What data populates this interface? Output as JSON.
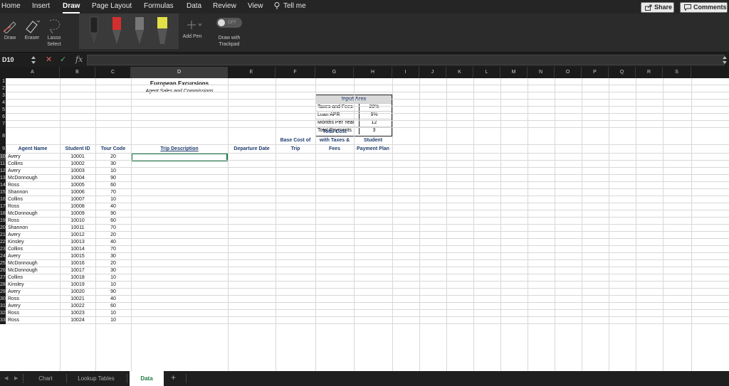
{
  "ribbon": {
    "tabs": [
      "Home",
      "Insert",
      "Draw",
      "Page Layout",
      "Formulas",
      "Data",
      "Review",
      "View"
    ],
    "active_tab": "Draw",
    "tell_me": "Tell me",
    "share": "Share",
    "comments": "Comments"
  },
  "toolbar": {
    "draw": "Draw",
    "eraser": "Eraser",
    "lasso_line1": "Lasso",
    "lasso_line2": "Select",
    "add_pen": "Add Pen",
    "toggle": "OFF",
    "trackpad_line1": "Draw with",
    "trackpad_line2": "Trackpad",
    "pen_colors": [
      "#222222",
      "#d32f2f",
      "#555555",
      "#e4e048"
    ]
  },
  "formula_bar": {
    "name_box": "D10",
    "cancel": "✕",
    "confirm": "✓",
    "fx": "fx",
    "value": ""
  },
  "columns": [
    "A",
    "B",
    "C",
    "D",
    "E",
    "F",
    "G",
    "H",
    "I",
    "J",
    "K",
    "L",
    "M",
    "N",
    "O",
    "P",
    "Q",
    "R",
    "S"
  ],
  "rows": [
    "1",
    "2",
    "3",
    "4",
    "5",
    "6",
    "7",
    "8",
    "9",
    "10",
    "11",
    "12",
    "13",
    "14",
    "15",
    "16",
    "17",
    "18",
    "19",
    "20",
    "21",
    "22",
    "23",
    "24",
    "25",
    "26",
    "27",
    "28",
    "29",
    "30",
    "31",
    "32",
    "33"
  ],
  "sheet": {
    "title": "European Excursions",
    "subtitle": "Agent Sales and Commissions",
    "input_area": {
      "header": "Input Area",
      "rows": [
        {
          "label": "Taxes and Fees",
          "value": "20%"
        },
        {
          "label": "Loan APR",
          "value": "9%"
        },
        {
          "label": "Months Per Year",
          "value": "12"
        },
        {
          "label": "Total Payments",
          "value": "3"
        }
      ]
    },
    "headers": {
      "agent": "Agent Name",
      "student_id": "Student ID",
      "tour_code": "Tour Code",
      "trip": "Trip Description",
      "departure": "Departure Date",
      "base_cost_1": "Base Cost of",
      "base_cost_2": "Trip",
      "total_1": "Total Cost",
      "total_2": "with Taxes &",
      "total_3": "Fees",
      "payment_1": "Student",
      "payment_2": "Payment Plan"
    },
    "data_rows": [
      {
        "agent": "Avery",
        "id": "10001",
        "code": "20"
      },
      {
        "agent": "Collins",
        "id": "10002",
        "code": "30"
      },
      {
        "agent": "Avery",
        "id": "10003",
        "code": "10"
      },
      {
        "agent": "McDonnough",
        "id": "10004",
        "code": "90"
      },
      {
        "agent": "Ross",
        "id": "10005",
        "code": "60"
      },
      {
        "agent": "Shannon",
        "id": "10006",
        "code": "70"
      },
      {
        "agent": "Collins",
        "id": "10007",
        "code": "10"
      },
      {
        "agent": "Ross",
        "id": "10008",
        "code": "40"
      },
      {
        "agent": "McDonnough",
        "id": "10009",
        "code": "90"
      },
      {
        "agent": "Ross",
        "id": "10010",
        "code": "60"
      },
      {
        "agent": "Shannon",
        "id": "10011",
        "code": "70"
      },
      {
        "agent": "Avery",
        "id": "10012",
        "code": "20"
      },
      {
        "agent": "Kinsley",
        "id": "10013",
        "code": "40"
      },
      {
        "agent": "Collins",
        "id": "10014",
        "code": "70"
      },
      {
        "agent": "Avery",
        "id": "10015",
        "code": "30"
      },
      {
        "agent": "McDonnough",
        "id": "10016",
        "code": "20"
      },
      {
        "agent": "McDonnough",
        "id": "10017",
        "code": "30"
      },
      {
        "agent": "Collins",
        "id": "10018",
        "code": "10"
      },
      {
        "agent": "Kinsley",
        "id": "10019",
        "code": "10"
      },
      {
        "agent": "Avery",
        "id": "10020",
        "code": "90"
      },
      {
        "agent": "Ross",
        "id": "10021",
        "code": "40"
      },
      {
        "agent": "Avery",
        "id": "10022",
        "code": "60"
      },
      {
        "agent": "Ross",
        "id": "10023",
        "code": "10"
      },
      {
        "agent": "Ross",
        "id": "10024",
        "code": "10"
      }
    ]
  },
  "sheet_tabs": [
    "Chart",
    "Lookup Tables",
    "Data"
  ],
  "active_sheet": "Data",
  "add_sheet": "+"
}
